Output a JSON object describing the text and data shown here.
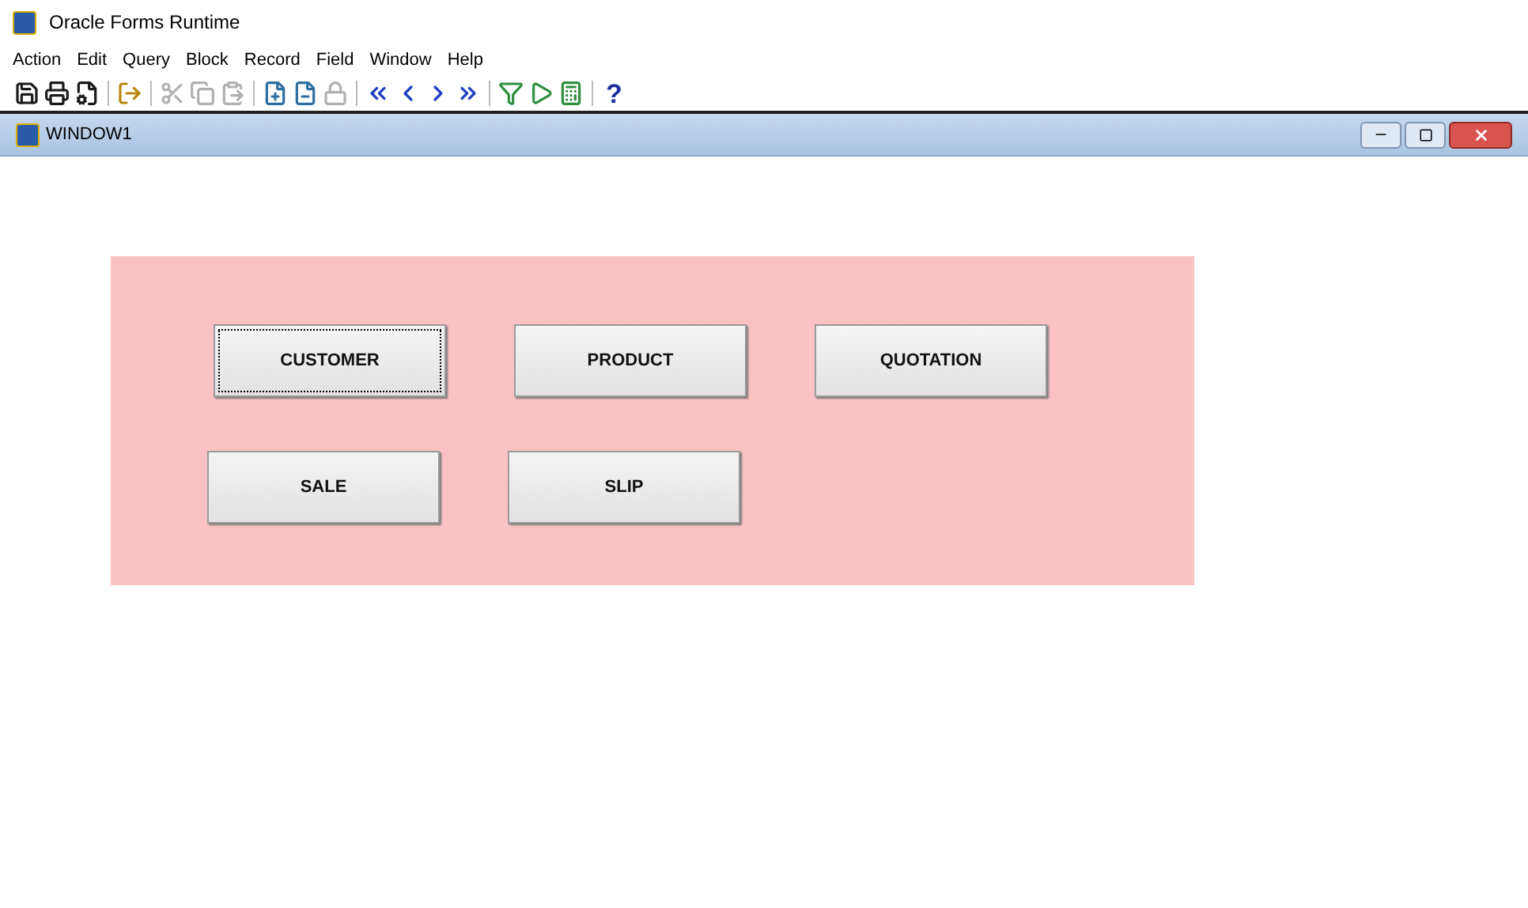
{
  "app_title": "Oracle Forms Runtime",
  "menu": [
    "Action",
    "Edit",
    "Query",
    "Block",
    "Record",
    "Field",
    "Window",
    "Help"
  ],
  "toolbar": [
    [
      {
        "disabled": false
      },
      {
        "disabled": false
      },
      {
        "disabled": false
      }
    ],
    [
      {
        "disabled": false
      }
    ],
    [
      {
        "disabled": true
      },
      {
        "disabled": true
      },
      {
        "disabled": true
      }
    ],
    [
      {
        "disabled": false
      },
      {
        "disabled": false
      },
      {
        "disabled": true
      }
    ],
    [
      {
        "disabled": false
      },
      {
        "disabled": false
      },
      {
        "disabled": false
      },
      {
        "disabled": false
      }
    ],
    [
      {
        "disabled": false
      },
      {
        "disabled": false
      },
      {
        "disabled": false
      }
    ]
  ],
  "help_glyph": "?",
  "window": {
    "title": "WINDOW1"
  },
  "button_rows": [
    [
      {
        "label": "CUSTOMER",
        "focused": true
      },
      {
        "label": "PRODUCT",
        "focused": false
      },
      {
        "label": "QUOTATION",
        "focused": false
      }
    ],
    [
      {
        "label": "SALE",
        "focused": false
      },
      {
        "label": "SLIP",
        "focused": false
      }
    ]
  ]
}
